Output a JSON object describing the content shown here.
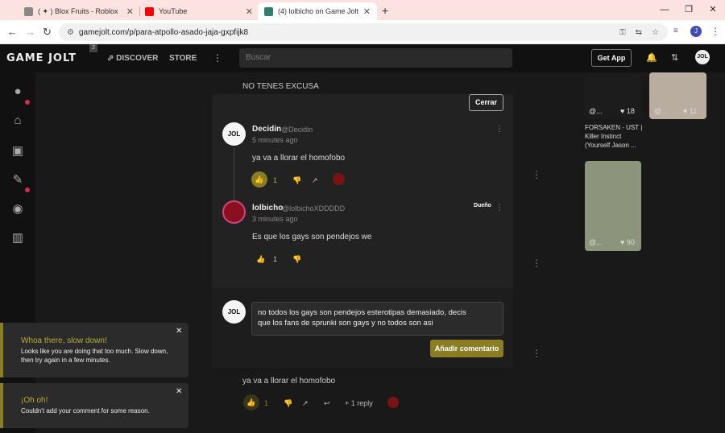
{
  "browser": {
    "tabs": [
      {
        "title": "( ✦ ) Blox Fruits - Roblox",
        "icon": "roblox-icon",
        "color": "#888888"
      },
      {
        "title": "YouTube",
        "icon": "youtube-icon",
        "color": "#ff0000"
      },
      {
        "title": "(4) lolbicho on Game Jolt: \"Para",
        "icon": "gamejolt-icon",
        "color": "#2f7f6f"
      }
    ],
    "url": "gamejolt.com/p/para-atpollo-asado-jaja-gxpfijk8",
    "profile_initial": "J"
  },
  "header": {
    "logo": "GAME JOLT",
    "logo_badge": "2",
    "nav": [
      "DISCOVER",
      "STORE"
    ],
    "search_placeholder": "Buscar",
    "get_app": "Get App",
    "avatar": "JOL"
  },
  "feed": {
    "top_text": "NO TENES EXCUSA",
    "bottom_comment": "ya va a llorar el homofobo",
    "bottom_likes": "1",
    "bottom_replies": "+ 1 reply"
  },
  "right_column": {
    "thumb1_count": "18",
    "thumb2_count": "11",
    "thumb1_title": "FORSAKEN - UST | Killer Instinct (Yourself Jason ...",
    "thumb3_count": "90",
    "handle_prefix": "@..."
  },
  "modal": {
    "close_label": "Cerrar",
    "comments": [
      {
        "author": "Decidin",
        "handle": "@Decidin",
        "time": "5 minutes ago",
        "body": "ya va a llorar el homofobo",
        "likes": "1"
      },
      {
        "author": "lolbicho",
        "handle": "@lolbichoXDDDDD",
        "time": "3 minutes ago",
        "body": "Es que los gays son pendejos we",
        "likes": "1",
        "badge": "Dueño"
      }
    ],
    "input_line1": "no todos los gays son pendejos esterotipas demasiado, decis",
    "input_line2": "que los fans de sprunki son gays y no todos son asi",
    "submit_label": "Añadir comentario"
  },
  "toasts": [
    {
      "title": "Whoa there, slow down!",
      "message": "Looks like you are doing that too much. Slow down, then try again in a few minutes."
    },
    {
      "title": "¡Oh oh!",
      "message": "Couldn't add your comment for some reason."
    }
  ]
}
